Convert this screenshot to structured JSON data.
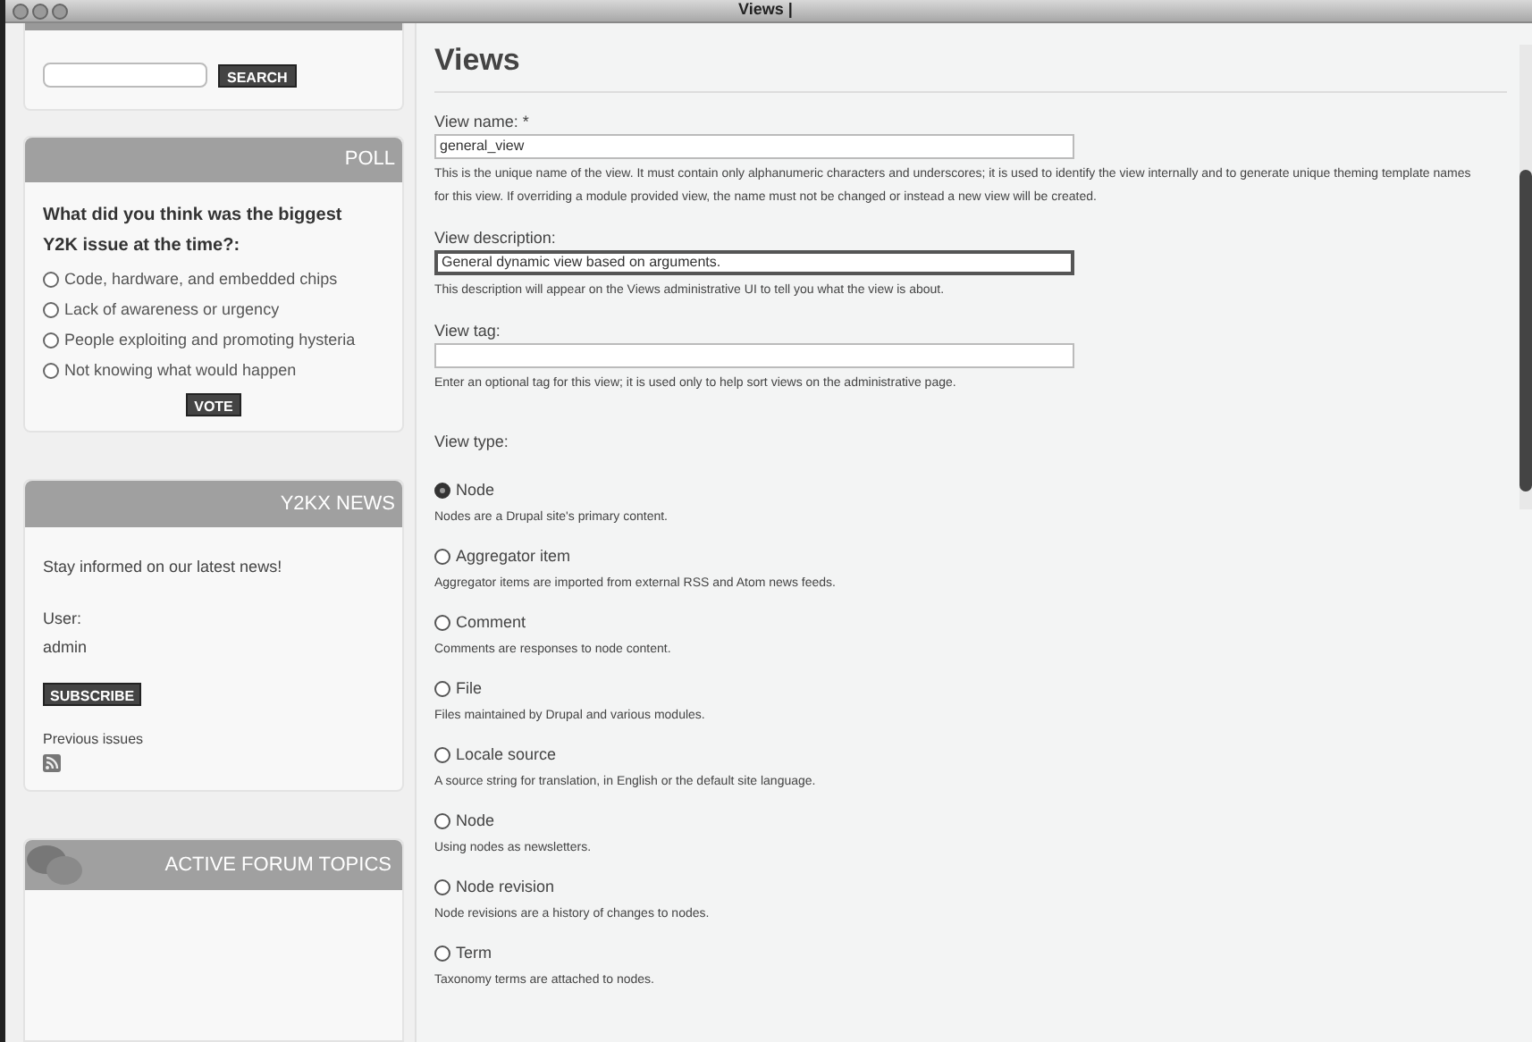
{
  "window": {
    "title": "Views |"
  },
  "sidebar": {
    "search": {
      "button": "SEARCH"
    },
    "poll": {
      "title": "POLL",
      "question": "What did you think was the biggest Y2K issue at the time?:",
      "options": [
        {
          "label": "Code, hardware, and embedded chips",
          "selected": false
        },
        {
          "label": "Lack of awareness or urgency",
          "selected": false
        },
        {
          "label": "People exploiting and promoting hysteria",
          "selected": false
        },
        {
          "label": "Not knowing what would happen",
          "selected": false
        }
      ],
      "button": "VOTE"
    },
    "news": {
      "title": "Y2KX NEWS",
      "text": "Stay informed on our latest news!",
      "user_label": "User:",
      "user": "admin",
      "button": "SUBSCRIBE",
      "previous": "Previous issues"
    },
    "forum": {
      "title": "ACTIVE FORUM TOPICS"
    }
  },
  "main": {
    "heading": "Views",
    "fields": [
      {
        "label": "View name: *",
        "value": "general_view",
        "help": "This is the unique name of the view. It must contain only alphanumeric characters and underscores; it is used to identify the view internally and to generate unique theming template names for this view. If overriding a module provided view, the name must not be changed or instead a new view will be created.",
        "focused": false
      },
      {
        "label": "View description:",
        "value": "General dynamic view based on arguments.",
        "help": "This description will appear on the Views administrative UI to tell you what the view is about.",
        "focused": true
      },
      {
        "label": "View tag:",
        "help": "Enter an optional tag for this view; it is used only to help sort views on the administrative page.",
        "focused": false
      }
    ],
    "type_label": "View type:",
    "types": [
      {
        "label": "Node",
        "help": "Nodes are a Drupal site's primary content.",
        "selected": true
      },
      {
        "label": "Aggregator item",
        "help": "Aggregator items are imported from external RSS and Atom news feeds.",
        "selected": false
      },
      {
        "label": "Comment",
        "help": "Comments are responses to node content.",
        "selected": false
      },
      {
        "label": "File",
        "help": "Files maintained by Drupal and various modules.",
        "selected": false
      },
      {
        "label": "Locale source",
        "help": "A source string for translation, in English or the default site language.",
        "selected": false
      },
      {
        "label": "Node",
        "help": "Using nodes as newsletters.",
        "selected": false
      },
      {
        "label": "Node revision",
        "help": "Node revisions are a history of changes to nodes.",
        "selected": false
      },
      {
        "label": "Term",
        "help": "Taxonomy terms are attached to nodes.",
        "selected": false
      }
    ]
  }
}
